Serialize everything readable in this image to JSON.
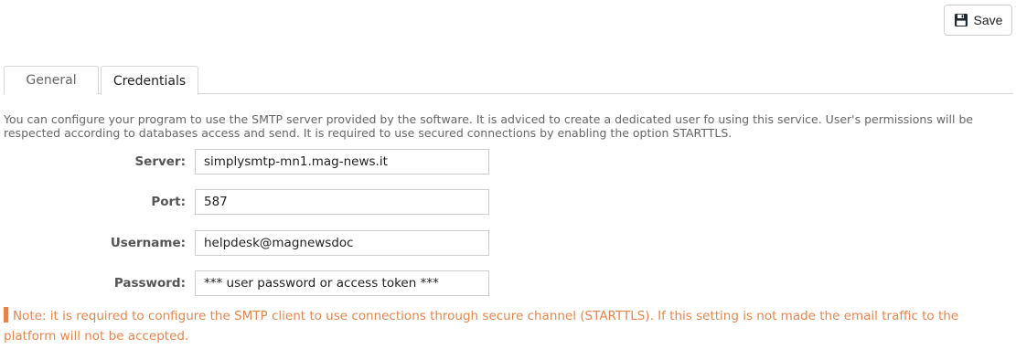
{
  "toolbar": {
    "save_label": "Save",
    "save_icon": "floppy-disk-icon"
  },
  "tabs": [
    {
      "label": "General",
      "active": false
    },
    {
      "label": "Credentials",
      "active": true
    }
  ],
  "description": "You can configure your program to use the SMTP server provided by the software. It is adviced to create a dedicated user fo using this service. User's permissions will be respected according to databases access and send. It is required to use secured connections by enabling the option STARTTLS.",
  "form": {
    "server": {
      "label": "Server:",
      "value": "simplysmtp-mn1.mag-news.it"
    },
    "port": {
      "label": "Port:",
      "value": "587"
    },
    "username": {
      "label": "Username:",
      "value": "helpdesk@magnewsdoc"
    },
    "password": {
      "label": "Password:",
      "value": "*** user password or access token ***"
    }
  },
  "note": {
    "text": "Note: it is required to configure the SMTP client to use connections through secure channel (STARTTLS). If this setting is not made the email traffic to the platform will not be accepted.",
    "color": "#e0864f"
  }
}
